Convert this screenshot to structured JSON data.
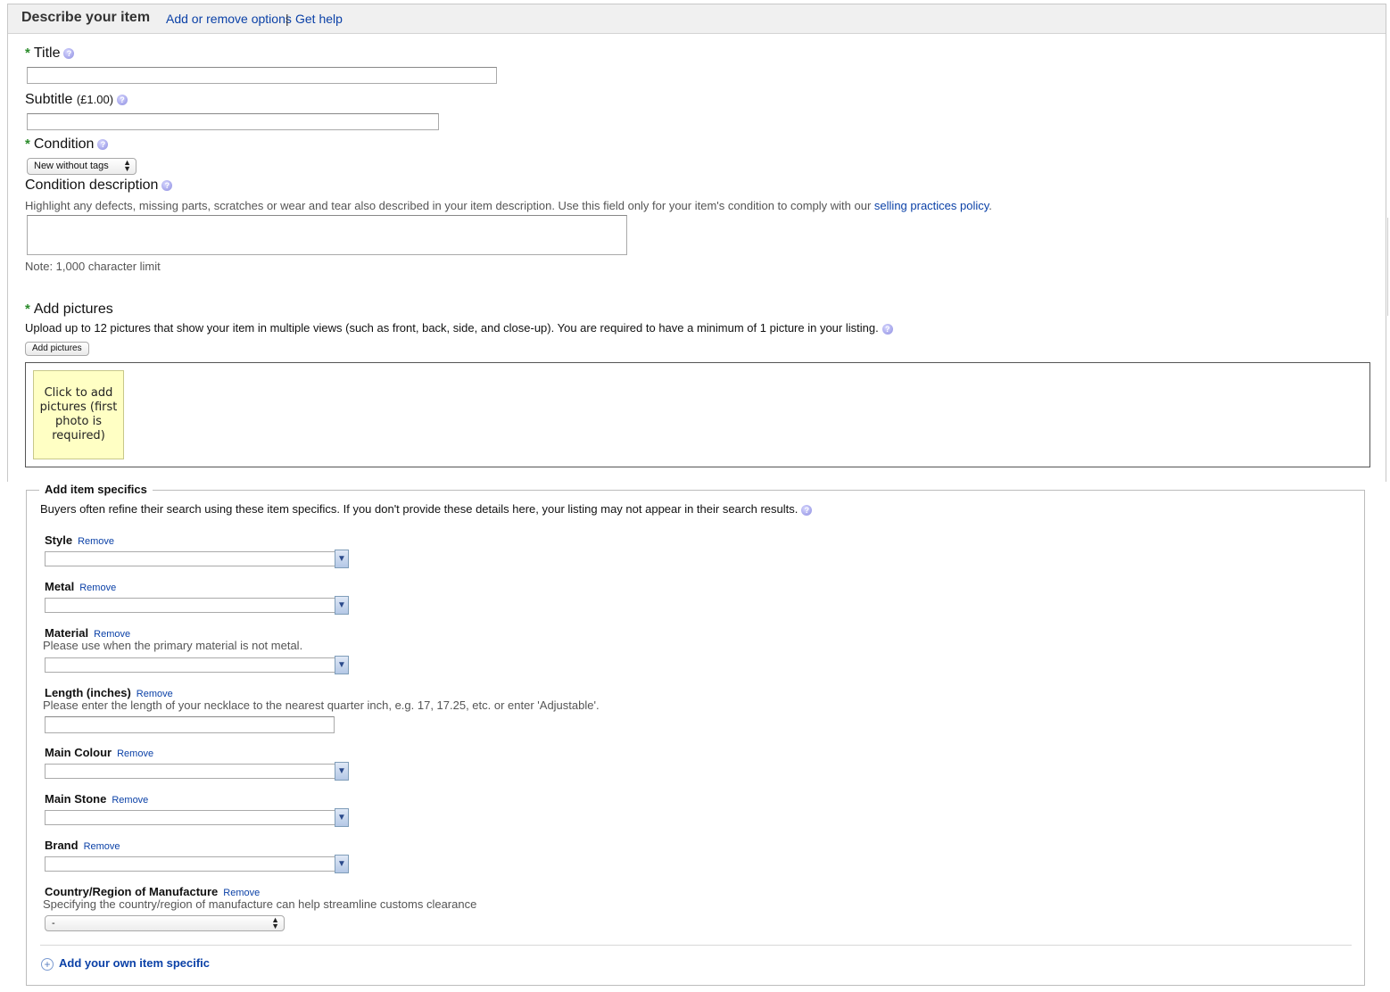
{
  "header": {
    "title": "Describe your item",
    "add_remove_label": "Add or remove options",
    "separator": "|",
    "help_label": "Get help"
  },
  "title_field": {
    "required_mark": "*",
    "label": "Title",
    "value": ""
  },
  "subtitle_field": {
    "label": "Subtitle",
    "price": "(£1.00)",
    "value": ""
  },
  "condition": {
    "required_mark": "*",
    "label": "Condition",
    "selected": "New without tags"
  },
  "condition_description": {
    "label": "Condition description",
    "hint_prefix": "Highlight any defects, missing parts, scratches or wear and tear also described in your item description. Use this field only for your item's condition to comply with our",
    "policy_link": "selling practices policy",
    "hint_suffix": ".",
    "value": "",
    "note": "Note: 1,000 character limit"
  },
  "pictures": {
    "required_mark": "*",
    "label": "Add pictures",
    "instructions": "Upload up to 12 pictures that show your item in multiple views (such as front, back, side, and close-up).  You are required to have a minimum of 1 picture in your listing.",
    "button_label": "Add pictures",
    "slot_text": "Click to add pictures (first photo is required)"
  },
  "item_specifics": {
    "legend": "Add item specifics",
    "intro": "Buyers often refine their search using these item specifics. If you don't provide these details here, your listing may not appear in their search results.",
    "remove_label": "Remove",
    "fields": {
      "style": {
        "label": "Style",
        "value": ""
      },
      "metal": {
        "label": "Metal",
        "value": ""
      },
      "material": {
        "label": "Material",
        "hint": "Please use when the primary material is not metal.",
        "value": ""
      },
      "length": {
        "label": "Length (inches)",
        "hint": "Please enter the length of your necklace to the nearest quarter inch, e.g. 17, 17.25, etc. or enter 'Adjustable'.",
        "value": ""
      },
      "main_colour": {
        "label": "Main Colour",
        "value": ""
      },
      "main_stone": {
        "label": "Main Stone",
        "value": ""
      },
      "brand": {
        "label": "Brand",
        "value": ""
      },
      "country": {
        "label": "Country/Region of Manufacture",
        "hint": "Specifying the country/region of manufacture can help streamline customs clearance",
        "selected": "-"
      }
    },
    "add_own_label": "Add your own item specific"
  },
  "icons": {
    "help": "help-icon",
    "dropdown": "chevron-down-icon",
    "add": "plus-icon"
  }
}
